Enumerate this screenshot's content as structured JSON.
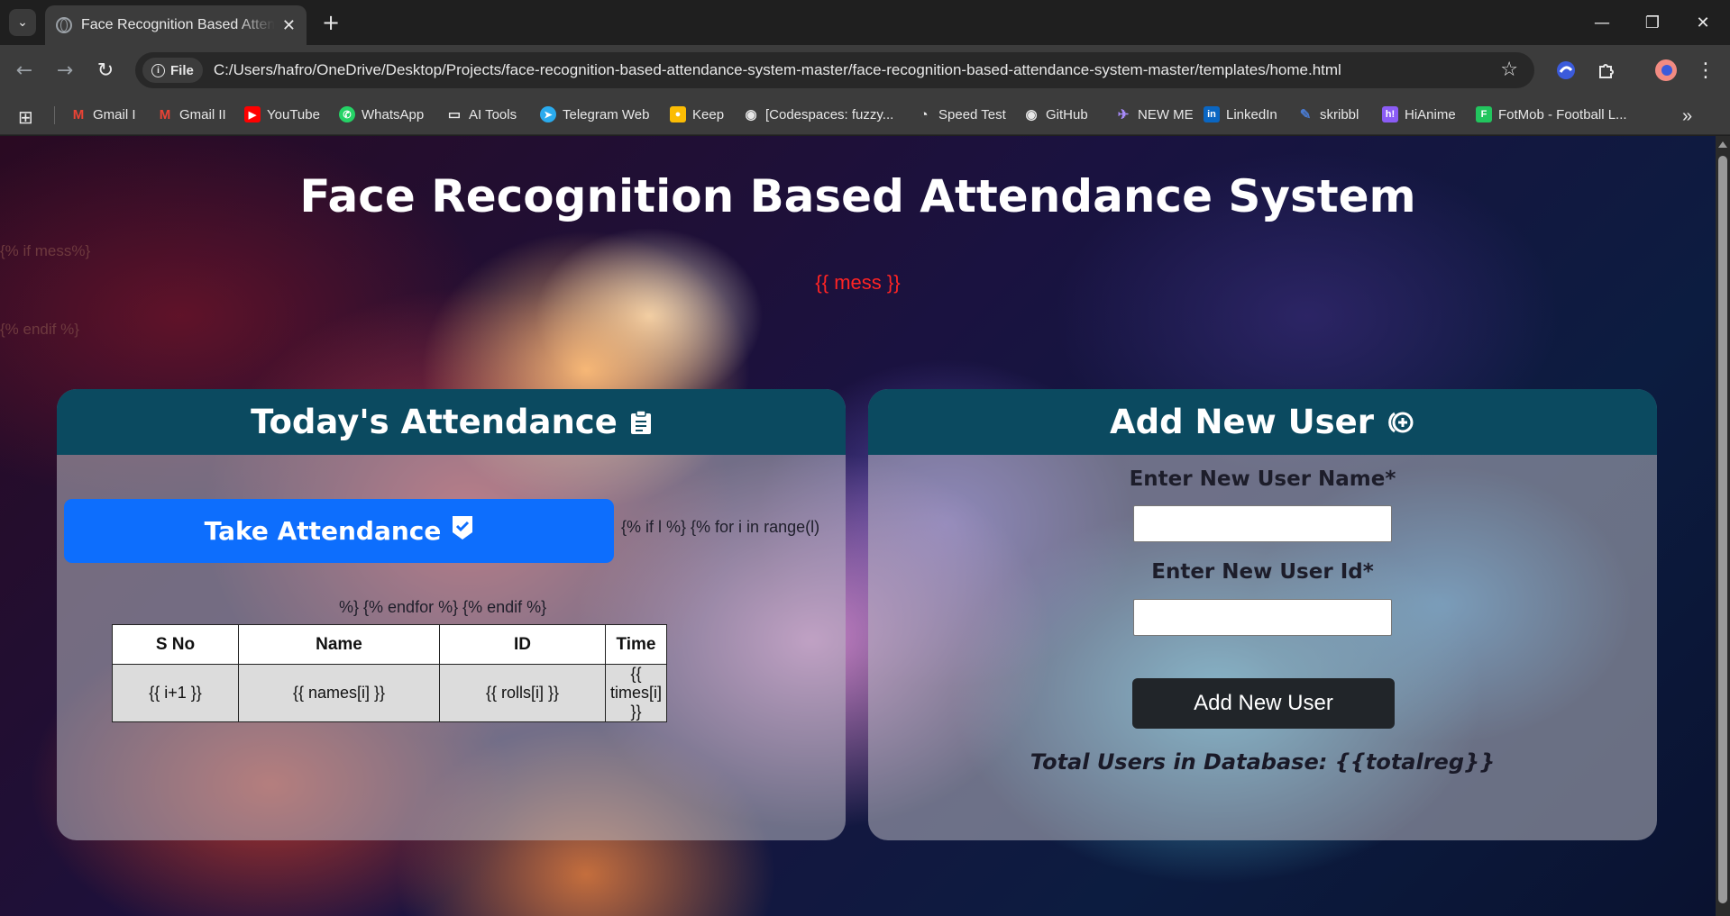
{
  "browser": {
    "tab_title": "Face Recognition Based Attendance System",
    "file_label": "File",
    "url": "C:/Users/hafro/OneDrive/Desktop/Projects/face-recognition-based-attendance-system-master/face-recognition-based-attendance-system-master/templates/home.html",
    "bookmarks": [
      {
        "label": "Gmail I",
        "icon": "gmail-icon",
        "color": "#ea4335"
      },
      {
        "label": "Gmail II",
        "icon": "gmail-icon",
        "color": "#ea4335"
      },
      {
        "label": "YouTube",
        "icon": "youtube-icon",
        "color": "#ff0000"
      },
      {
        "label": "WhatsApp",
        "icon": "whatsapp-icon",
        "color": "#25d366"
      },
      {
        "label": "AI Tools",
        "icon": "folder-icon",
        "color": "#e8e8e8"
      },
      {
        "label": "Telegram Web",
        "icon": "telegram-icon",
        "color": "#2aabee"
      },
      {
        "label": "Keep",
        "icon": "keep-icon",
        "color": "#fbbc04"
      },
      {
        "label": "[Codespaces: fuzzy...",
        "icon": "github-icon",
        "color": "#e8e8e8"
      },
      {
        "label": "Speed Test",
        "icon": "speedtest-icon",
        "color": "#e8e8e8"
      },
      {
        "label": "GitHub",
        "icon": "github-icon",
        "color": "#e8e8e8"
      },
      {
        "label": "NEW ME",
        "icon": "plane-icon",
        "color": "#a78bfa"
      },
      {
        "label": "LinkedIn",
        "icon": "linkedin-icon",
        "color": "#0a66c2"
      },
      {
        "label": "skribbl",
        "icon": "pencil-icon",
        "color": "#4a7bd0"
      },
      {
        "label": "HiAnime",
        "icon": "hianime-icon",
        "color": "#8b5cf6"
      },
      {
        "label": "FotMob - Football L...",
        "icon": "fotmob-icon",
        "color": "#22c55e"
      }
    ]
  },
  "page": {
    "title": "Face Recognition Based Attendance System",
    "jinja_if_mess": "{% if mess%}",
    "mess": "{{ mess }}",
    "jinja_endif": "{% endif %}"
  },
  "attendance": {
    "heading": "Today's Attendance",
    "take_button": "Take Attendance",
    "loop_start": "{% if l %} {% for i in range(l)",
    "loop_end": "%} {% endfor %} {% endif %}",
    "columns": [
      "S No",
      "Name",
      "ID",
      "Time"
    ],
    "row": [
      "{{ i+1 }}",
      "{{ names[i] }}",
      "{{ rolls[i] }}",
      "{{ times[i] }}"
    ]
  },
  "add_user": {
    "heading": "Add New User",
    "name_label": "Enter New User Name*",
    "id_label": "Enter New User Id*",
    "name_value": "",
    "id_value": "",
    "button": "Add New User",
    "total": "Total Users in Database: {{totalreg}}"
  },
  "colors": {
    "card_header": "#0b4a60",
    "primary_button": "#0d6efd",
    "dark_button": "#212529",
    "message": "#ff2424"
  }
}
